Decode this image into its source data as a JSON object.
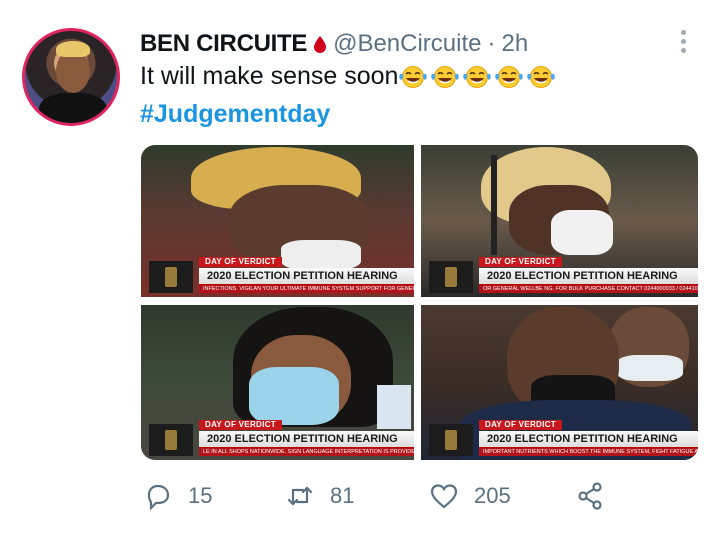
{
  "tweet": {
    "display_name": "BEN CIRCUITE",
    "handle": "@BenCircuite",
    "separator": "·",
    "time": "2h",
    "text": "It will make sense soon",
    "emoji_icon": "tears-of-joy-emoji",
    "emoji_count": 5,
    "hashtag": "#Judgementday"
  },
  "media": [
    {
      "tag": "DAY OF VERDICT",
      "headline": "2020 ELECTION PETITION HEARING",
      "ticker": "INFECTIONS. VIGILAN YOUR ULTIMATE IMMUNE SYSTEM SUPPORT FOR GENERAL WELLBE"
    },
    {
      "tag": "DAY OF VERDICT",
      "headline": "2020 ELECTION PETITION HEARING",
      "ticker": "OR GENERAL WELLBE NG. FOR BULK PURCHASE CONTACT 0244000033 / 0244103934"
    },
    {
      "tag": "DAY OF VERDICT",
      "headline": "2020 ELECTION PETITION HEARING",
      "ticker": "LE IN ALL SHOPS NATIONWIDE.          SIGN LANGUAGE INTERPRETATION IS PROVIDED BY YOUTH"
    },
    {
      "tag": "DAY OF VERDICT",
      "headline": "2020 ELECTION PETITION HEARING",
      "ticker": "IMPORTANT NUTRIENTS WHICH BOOST THE IMMUNE SYSTEM, FIGHT FATIGUE AND"
    }
  ],
  "actions": {
    "replies": "15",
    "retweets": "81",
    "likes": "205"
  },
  "colors": {
    "link": "#1b95e0",
    "secondary_text": "#5b7083",
    "avatar_ring": "#e0245e",
    "drop": "#d0021b",
    "banner_red": "#c7191d"
  }
}
